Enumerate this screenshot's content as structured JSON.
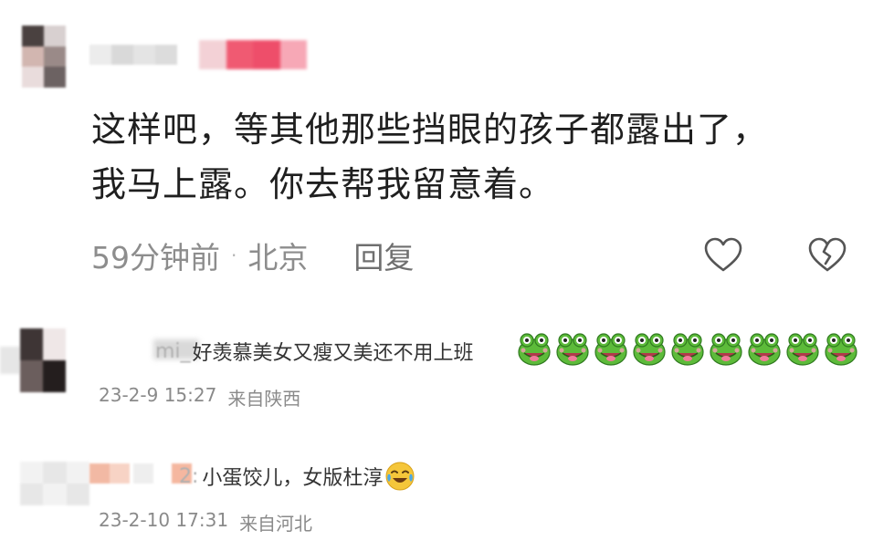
{
  "comment1": {
    "text": "这样吧，等其他那些挡眼的孩子都露出了，我马上露。你去帮我留意着。",
    "time": "59分钟前",
    "separator": "·",
    "location": "北京",
    "reply_label": "回复",
    "icons": [
      "heart-outline-icon",
      "broken-heart-icon"
    ]
  },
  "comment2": {
    "name_fragment": "mi_",
    "text": "好羡慕美女又瘦又美还不用上班",
    "emoji": "frog-emoji",
    "emoji_count": 9,
    "date": "23-2-9 15:27",
    "source": "来自陕西"
  },
  "comment3": {
    "prefix": "2:",
    "text": "小蛋饺儿，女版杜淳",
    "emoji": "laughing-tears-emoji",
    "date": "23-2-10 17:31",
    "source": "来自河北"
  },
  "colors": {
    "meta_gray": "#8d8d8d",
    "text_dark": "#1f1f1f",
    "frog_green": "#5dbb3a",
    "emoji_yellow": "#f5c63a"
  }
}
